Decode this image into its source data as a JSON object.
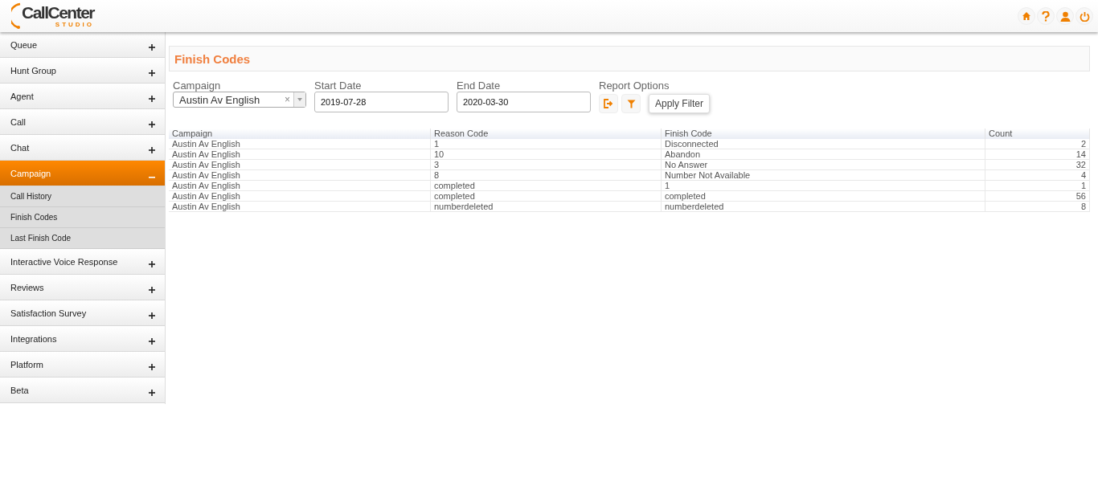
{
  "header": {
    "logo": {
      "main": "CallCenter",
      "sub": "STUDIO"
    }
  },
  "sidebar": {
    "items": [
      {
        "label": "Queue",
        "expanded": false
      },
      {
        "label": "Hunt Group",
        "expanded": false
      },
      {
        "label": "Agent",
        "expanded": false
      },
      {
        "label": "Call",
        "expanded": false
      },
      {
        "label": "Chat",
        "expanded": false
      },
      {
        "label": "Campaign",
        "expanded": true,
        "children": [
          {
            "label": "Call History"
          },
          {
            "label": "Finish Codes"
          },
          {
            "label": "Last Finish Code"
          }
        ]
      },
      {
        "label": "Interactive Voice Response",
        "expanded": false
      },
      {
        "label": "Reviews",
        "expanded": false
      },
      {
        "label": "Satisfaction Survey",
        "expanded": false
      },
      {
        "label": "Integrations",
        "expanded": false
      },
      {
        "label": "Platform",
        "expanded": false
      },
      {
        "label": "Beta",
        "expanded": false
      }
    ]
  },
  "page_title": "Finish Codes",
  "filters": {
    "campaign": {
      "label": "Campaign",
      "value": "Austin Av English",
      "clear": "×"
    },
    "start_date": {
      "label": "Start Date",
      "value": "2019-07-28"
    },
    "end_date": {
      "label": "End Date",
      "value": "2020-03-30"
    },
    "report_options": {
      "label": "Report Options"
    },
    "tooltip": "Apply Filter"
  },
  "table": {
    "columns": [
      "Campaign",
      "Reason Code",
      "Finish Code",
      "Count"
    ],
    "rows": [
      [
        "Austin Av English",
        "1",
        "Disconnected",
        "2"
      ],
      [
        "Austin Av English",
        "10",
        "Abandon",
        "14"
      ],
      [
        "Austin Av English",
        "3",
        "No Answer",
        "32"
      ],
      [
        "Austin Av English",
        "8",
        "Number Not Available",
        "4"
      ],
      [
        "Austin Av English",
        "completed",
        "1",
        "1"
      ],
      [
        "Austin Av English",
        "completed",
        "completed",
        "56"
      ],
      [
        "Austin Av English",
        "numberdeleted",
        "numberdeleted",
        "8"
      ]
    ]
  }
}
